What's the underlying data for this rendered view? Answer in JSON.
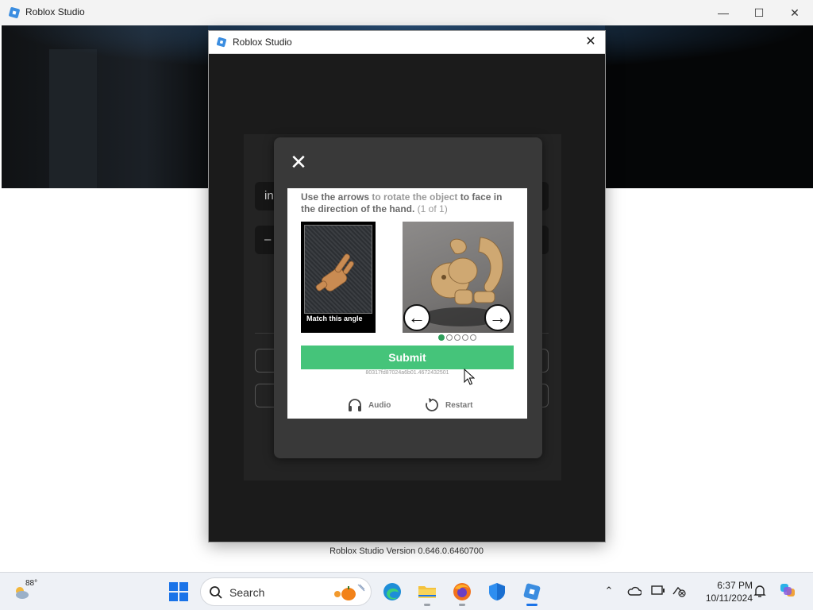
{
  "outer_window": {
    "title": "Roblox Studio",
    "minimize_label": "—",
    "maximize_label": "☐",
    "close_label": "✕"
  },
  "version_text": "Roblox Studio Version 0.646.0.6460700",
  "dialog": {
    "title": "Roblox Studio",
    "close_label": "✕"
  },
  "login": {
    "field1_text": "in",
    "field2_text": "–"
  },
  "captcha": {
    "close_label": "✕",
    "instruction": {
      "part1": "Use the arrows",
      "part2": " to rotate the object ",
      "part3": "to face in the",
      "part4": " direction of the hand.",
      "part5": " (1 of 1)"
    },
    "reference_caption": "Match this angle",
    "left_arrow": "←",
    "right_arrow": "→",
    "page_dots": {
      "total": 5,
      "active": 1
    },
    "submit_label": "Submit",
    "session_id": "80317fd87024a6b01.4672432501",
    "audio_label": "Audio",
    "restart_label": "Restart"
  },
  "taskbar": {
    "weather_temp": "88°",
    "search_label": "Search",
    "time": "6:37 PM",
    "date": "10/11/2024",
    "apps": [
      "start-icon",
      "edge-icon",
      "file-explorer-icon",
      "firefox-icon",
      "defender-icon",
      "roblox-studio-icon"
    ]
  },
  "colors": {
    "submit": "#45c47a",
    "dot_active": "#2e9e5b",
    "dialog_bg": "#1b1b1b",
    "captcha_shell": "#393939"
  }
}
